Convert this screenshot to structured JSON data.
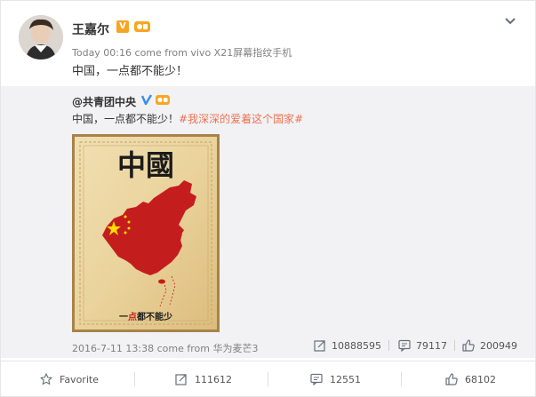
{
  "post": {
    "author": "王嘉尔",
    "timestamp": "Today 00:16",
    "source": "come from vivo X21屏幕指纹手机",
    "text": "中国，一点都不能少！",
    "badges": [
      "v-verified-badge",
      "level-badge"
    ],
    "menu_icon": "chevron-down-icon"
  },
  "repost": {
    "author": "@共青团中央",
    "text_plain": "中国，一点都不能少！",
    "hashtag": "#我深深的爱着这个国家#",
    "poster": {
      "title": "中國",
      "caption_prefix": "一",
      "caption_highlight": "点",
      "caption_suffix": "都不能少"
    },
    "timestamp": "2016-7-11 13:38",
    "source": "come from 华为麦芒3",
    "reposts": "10888595",
    "comments": "79117",
    "likes": "200949"
  },
  "actions": {
    "favorite_label": "Favorite",
    "repost_count": "111612",
    "comment_count": "12551",
    "like_count": "68102"
  },
  "colors": {
    "hashtag": "#eb7350",
    "verified": "#f6a623",
    "blue_verified": "#3b8fe4",
    "flag_red": "#cc1a1a",
    "star_yellow": "#ffde00"
  }
}
